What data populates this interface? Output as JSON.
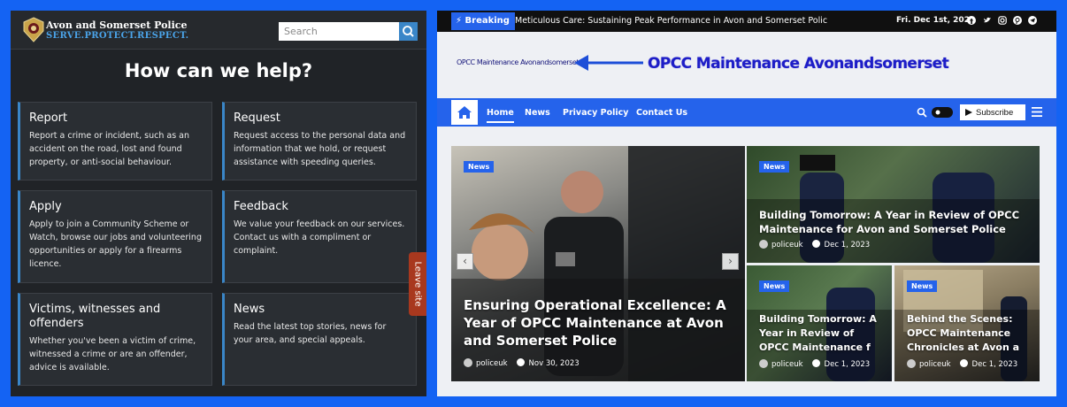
{
  "left": {
    "brand_name": "Avon and Somerset Police",
    "brand_tagline": "SERVE.PROTECT.RESPECT.",
    "search_placeholder": "Search",
    "heading": "How can we help?",
    "cards": [
      {
        "title": "Report",
        "desc": "Report a crime or incident, such as an accident on the road, lost and found property, or anti-social behaviour."
      },
      {
        "title": "Request",
        "desc": "Request access to the personal data and information that we hold, or request assistance with speeding queries."
      },
      {
        "title": "Apply",
        "desc": "Apply to join a Community Scheme or Watch, browse our jobs and volunteering opportunities or apply for a firearms licence."
      },
      {
        "title": "Feedback",
        "desc": "We value your feedback on our services. Contact us with a compliment or complaint."
      },
      {
        "title": "Victims, witnesses and offenders",
        "desc": "Whether you've been a victim of crime, witnessed a crime or are an offender, advice is available."
      },
      {
        "title": "News",
        "desc": "Read the latest top stories, news for your area, and special appeals."
      }
    ],
    "leave_site": "Leave site"
  },
  "right": {
    "breaking_label": "Breaking",
    "ticker": "Meticulous Care: Sustaining Peak Performance in Avon and Somerset Polic",
    "date": "Fri. Dec 1st, 2023",
    "social_icons": [
      "facebook-icon",
      "twitter-icon",
      "instagram-icon",
      "pinterest-icon",
      "telegram-icon"
    ],
    "logo_small": "OPCC Maintenance Avonandsomerset",
    "logo_big": "OPCC Maintenance Avonandsomerset",
    "nav": [
      "Home",
      "News",
      "Privacy Policy",
      "Contact Us"
    ],
    "subscribe": "Subscribe",
    "featured": {
      "badge": "News",
      "title": "Ensuring Operational Excellence: A Year of OPCC Maintenance at Avon and Somerset Police",
      "author": "policeuk",
      "date": "Nov 30, 2023"
    },
    "side_posts": [
      {
        "badge": "News",
        "title": "Building Tomorrow: A Year in Review of OPCC Maintenance for Avon and Somerset Police",
        "author": "policeuk",
        "date": "Dec 1, 2023"
      },
      {
        "badge": "News",
        "title": "Building Tomorrow: A Year in Review of OPCC Maintenance f",
        "author": "policeuk",
        "date": "Dec 1, 2023"
      },
      {
        "badge": "News",
        "title": "Behind the Scenes: OPCC Maintenance Chronicles at Avon a",
        "author": "policeuk",
        "date": "Dec 1, 2023"
      }
    ],
    "colors": {
      "accent": "#2563eb",
      "topbar": "#101010"
    }
  }
}
